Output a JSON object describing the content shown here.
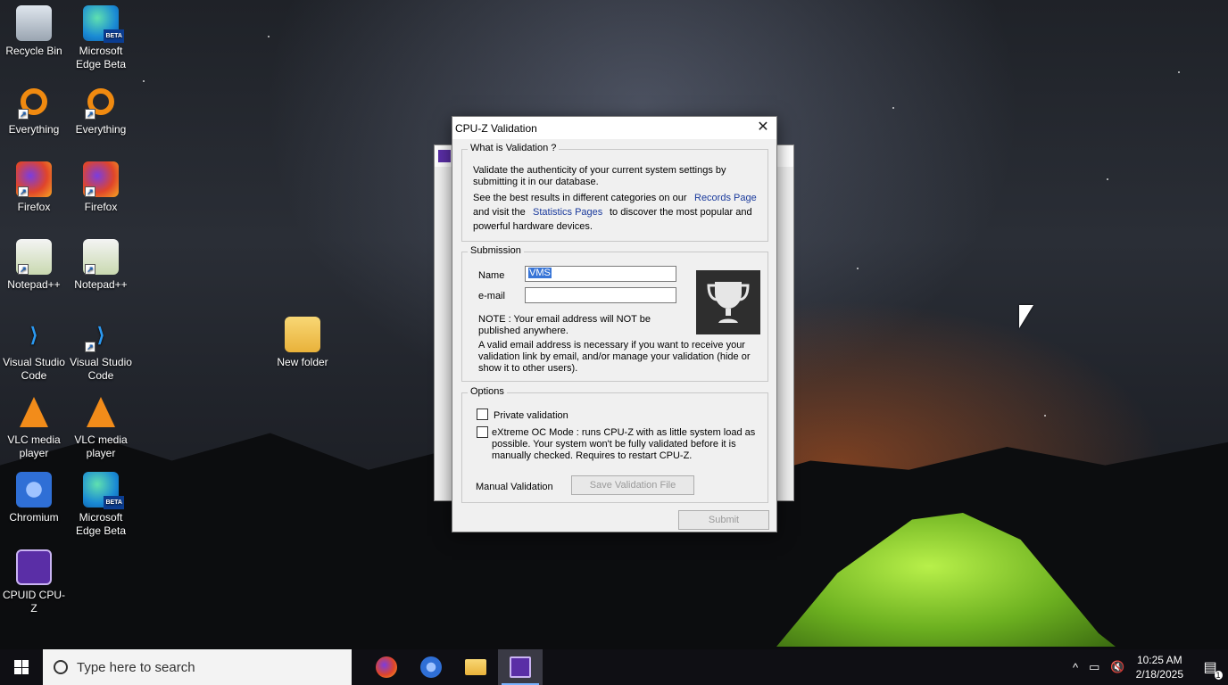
{
  "desktop": {
    "icons": [
      {
        "label": "Recycle Bin",
        "icon": "recycle-bin-icon"
      },
      {
        "label": "Microsoft Edge Beta",
        "icon": "edge-beta-icon"
      },
      {
        "label": "Everything",
        "icon": "everything-icon"
      },
      {
        "label": "Everything",
        "icon": "everything-icon"
      },
      {
        "label": "Firefox",
        "icon": "firefox-icon"
      },
      {
        "label": "Firefox",
        "icon": "firefox-icon"
      },
      {
        "label": "Notepad++",
        "icon": "notepadpp-icon"
      },
      {
        "label": "Notepad++",
        "icon": "notepadpp-icon"
      },
      {
        "label": "Visual Studio Code",
        "icon": "vscode-icon"
      },
      {
        "label": "Visual Studio Code",
        "icon": "vscode-icon"
      },
      {
        "label": "VLC media player",
        "icon": "vlc-icon"
      },
      {
        "label": "VLC media player",
        "icon": "vlc-icon"
      },
      {
        "label": "Chromium",
        "icon": "chromium-icon"
      },
      {
        "label": "Microsoft Edge Beta",
        "icon": "edge-beta-icon"
      },
      {
        "label": "CPUID CPU-Z",
        "icon": "cpuz-icon"
      },
      {
        "label": "New folder",
        "icon": "folder-icon"
      }
    ],
    "edge_badge": "BETA"
  },
  "dialog": {
    "title": "CPU-Z Validation",
    "close_symbol": "✕",
    "what_is": {
      "legend": "What is Validation ?",
      "line1": "Validate the authenticity of your current system settings by",
      "line2": "submitting it in our database.",
      "line3_pre": "See the best results in different categories on our",
      "records_link": "Records Page",
      "line4_pre": "and visit the",
      "stats_link": "Statistics Pages",
      "line4_post": "to discover the most popular and",
      "line5": "powerful hardware devices."
    },
    "submission": {
      "legend": "Submission",
      "name_label": "Name",
      "name_value": "VMS",
      "email_label": "e-mail",
      "email_value": "",
      "note1": "NOTE : Your email address will NOT be",
      "note2": "published anywhere.",
      "note3": "A valid email address is necessary if you want to receive your",
      "note4": "validation link by email, and/or manage your validation (hide or",
      "note5": "show it to other users)."
    },
    "options": {
      "legend": "Options",
      "private_label": "Private validation",
      "private_checked": false,
      "extreme_line1": "eXtreme OC Mode : runs CPU-Z with as little system load as",
      "extreme_line2": "possible. Your system won't be fully validated before it is",
      "extreme_line3": "manually checked. Requires to restart CPU-Z.",
      "extreme_checked": false,
      "manual_label": "Manual Validation",
      "save_button": "Save Validation File"
    },
    "submit_button": "Submit"
  },
  "taskbar": {
    "search_placeholder": "Type here to search",
    "apps": [
      "firefox-icon",
      "chromium-icon",
      "file-explorer-icon",
      "cpuz-icon"
    ],
    "tray": {
      "chevron": "^",
      "time": "10:25 AM",
      "date": "2/18/2025",
      "notification_count": "1"
    }
  },
  "colors": {
    "link": "#1a3a9c",
    "selection": "#3875d7",
    "taskbar": "#0f0f14"
  }
}
